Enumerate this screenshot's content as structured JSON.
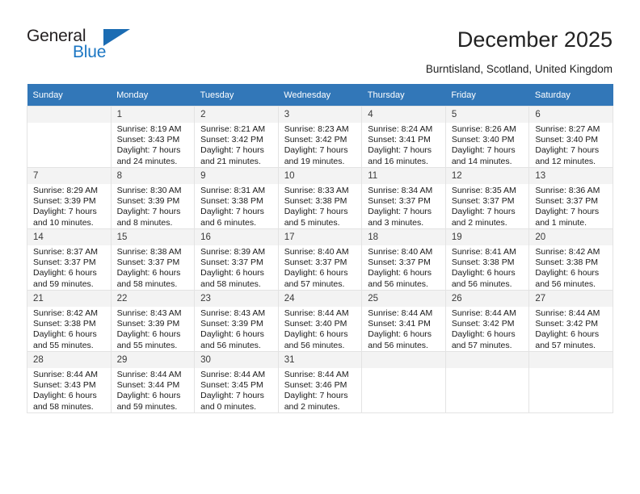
{
  "brand": {
    "name_part1": "General",
    "name_part2": "Blue",
    "triangle_icon": "blue-triangle-icon"
  },
  "header": {
    "title": "December 2025",
    "subtitle": "Burntisland, Scotland, United Kingdom"
  },
  "colors": {
    "header_row": "#3277b8",
    "brand_blue": "#1b76c3",
    "daynum_bg": "#f3f3f3",
    "cell_border": "#e3e3e3"
  },
  "weekday_headers": [
    "Sunday",
    "Monday",
    "Tuesday",
    "Wednesday",
    "Thursday",
    "Friday",
    "Saturday"
  ],
  "weeks": [
    [
      {
        "empty": true,
        "day": "",
        "sunrise": "",
        "sunset": "",
        "daylight1": "",
        "daylight2": ""
      },
      {
        "empty": false,
        "day": "1",
        "sunrise": "Sunrise: 8:19 AM",
        "sunset": "Sunset: 3:43 PM",
        "daylight1": "Daylight: 7 hours",
        "daylight2": "and 24 minutes."
      },
      {
        "empty": false,
        "day": "2",
        "sunrise": "Sunrise: 8:21 AM",
        "sunset": "Sunset: 3:42 PM",
        "daylight1": "Daylight: 7 hours",
        "daylight2": "and 21 minutes."
      },
      {
        "empty": false,
        "day": "3",
        "sunrise": "Sunrise: 8:23 AM",
        "sunset": "Sunset: 3:42 PM",
        "daylight1": "Daylight: 7 hours",
        "daylight2": "and 19 minutes."
      },
      {
        "empty": false,
        "day": "4",
        "sunrise": "Sunrise: 8:24 AM",
        "sunset": "Sunset: 3:41 PM",
        "daylight1": "Daylight: 7 hours",
        "daylight2": "and 16 minutes."
      },
      {
        "empty": false,
        "day": "5",
        "sunrise": "Sunrise: 8:26 AM",
        "sunset": "Sunset: 3:40 PM",
        "daylight1": "Daylight: 7 hours",
        "daylight2": "and 14 minutes."
      },
      {
        "empty": false,
        "day": "6",
        "sunrise": "Sunrise: 8:27 AM",
        "sunset": "Sunset: 3:40 PM",
        "daylight1": "Daylight: 7 hours",
        "daylight2": "and 12 minutes."
      }
    ],
    [
      {
        "empty": false,
        "day": "7",
        "sunrise": "Sunrise: 8:29 AM",
        "sunset": "Sunset: 3:39 PM",
        "daylight1": "Daylight: 7 hours",
        "daylight2": "and 10 minutes."
      },
      {
        "empty": false,
        "day": "8",
        "sunrise": "Sunrise: 8:30 AM",
        "sunset": "Sunset: 3:39 PM",
        "daylight1": "Daylight: 7 hours",
        "daylight2": "and 8 minutes."
      },
      {
        "empty": false,
        "day": "9",
        "sunrise": "Sunrise: 8:31 AM",
        "sunset": "Sunset: 3:38 PM",
        "daylight1": "Daylight: 7 hours",
        "daylight2": "and 6 minutes."
      },
      {
        "empty": false,
        "day": "10",
        "sunrise": "Sunrise: 8:33 AM",
        "sunset": "Sunset: 3:38 PM",
        "daylight1": "Daylight: 7 hours",
        "daylight2": "and 5 minutes."
      },
      {
        "empty": false,
        "day": "11",
        "sunrise": "Sunrise: 8:34 AM",
        "sunset": "Sunset: 3:37 PM",
        "daylight1": "Daylight: 7 hours",
        "daylight2": "and 3 minutes."
      },
      {
        "empty": false,
        "day": "12",
        "sunrise": "Sunrise: 8:35 AM",
        "sunset": "Sunset: 3:37 PM",
        "daylight1": "Daylight: 7 hours",
        "daylight2": "and 2 minutes."
      },
      {
        "empty": false,
        "day": "13",
        "sunrise": "Sunrise: 8:36 AM",
        "sunset": "Sunset: 3:37 PM",
        "daylight1": "Daylight: 7 hours",
        "daylight2": "and 1 minute."
      }
    ],
    [
      {
        "empty": false,
        "day": "14",
        "sunrise": "Sunrise: 8:37 AM",
        "sunset": "Sunset: 3:37 PM",
        "daylight1": "Daylight: 6 hours",
        "daylight2": "and 59 minutes."
      },
      {
        "empty": false,
        "day": "15",
        "sunrise": "Sunrise: 8:38 AM",
        "sunset": "Sunset: 3:37 PM",
        "daylight1": "Daylight: 6 hours",
        "daylight2": "and 58 minutes."
      },
      {
        "empty": false,
        "day": "16",
        "sunrise": "Sunrise: 8:39 AM",
        "sunset": "Sunset: 3:37 PM",
        "daylight1": "Daylight: 6 hours",
        "daylight2": "and 58 minutes."
      },
      {
        "empty": false,
        "day": "17",
        "sunrise": "Sunrise: 8:40 AM",
        "sunset": "Sunset: 3:37 PM",
        "daylight1": "Daylight: 6 hours",
        "daylight2": "and 57 minutes."
      },
      {
        "empty": false,
        "day": "18",
        "sunrise": "Sunrise: 8:40 AM",
        "sunset": "Sunset: 3:37 PM",
        "daylight1": "Daylight: 6 hours",
        "daylight2": "and 56 minutes."
      },
      {
        "empty": false,
        "day": "19",
        "sunrise": "Sunrise: 8:41 AM",
        "sunset": "Sunset: 3:38 PM",
        "daylight1": "Daylight: 6 hours",
        "daylight2": "and 56 minutes."
      },
      {
        "empty": false,
        "day": "20",
        "sunrise": "Sunrise: 8:42 AM",
        "sunset": "Sunset: 3:38 PM",
        "daylight1": "Daylight: 6 hours",
        "daylight2": "and 56 minutes."
      }
    ],
    [
      {
        "empty": false,
        "day": "21",
        "sunrise": "Sunrise: 8:42 AM",
        "sunset": "Sunset: 3:38 PM",
        "daylight1": "Daylight: 6 hours",
        "daylight2": "and 55 minutes."
      },
      {
        "empty": false,
        "day": "22",
        "sunrise": "Sunrise: 8:43 AM",
        "sunset": "Sunset: 3:39 PM",
        "daylight1": "Daylight: 6 hours",
        "daylight2": "and 55 minutes."
      },
      {
        "empty": false,
        "day": "23",
        "sunrise": "Sunrise: 8:43 AM",
        "sunset": "Sunset: 3:39 PM",
        "daylight1": "Daylight: 6 hours",
        "daylight2": "and 56 minutes."
      },
      {
        "empty": false,
        "day": "24",
        "sunrise": "Sunrise: 8:44 AM",
        "sunset": "Sunset: 3:40 PM",
        "daylight1": "Daylight: 6 hours",
        "daylight2": "and 56 minutes."
      },
      {
        "empty": false,
        "day": "25",
        "sunrise": "Sunrise: 8:44 AM",
        "sunset": "Sunset: 3:41 PM",
        "daylight1": "Daylight: 6 hours",
        "daylight2": "and 56 minutes."
      },
      {
        "empty": false,
        "day": "26",
        "sunrise": "Sunrise: 8:44 AM",
        "sunset": "Sunset: 3:42 PM",
        "daylight1": "Daylight: 6 hours",
        "daylight2": "and 57 minutes."
      },
      {
        "empty": false,
        "day": "27",
        "sunrise": "Sunrise: 8:44 AM",
        "sunset": "Sunset: 3:42 PM",
        "daylight1": "Daylight: 6 hours",
        "daylight2": "and 57 minutes."
      }
    ],
    [
      {
        "empty": false,
        "day": "28",
        "sunrise": "Sunrise: 8:44 AM",
        "sunset": "Sunset: 3:43 PM",
        "daylight1": "Daylight: 6 hours",
        "daylight2": "and 58 minutes."
      },
      {
        "empty": false,
        "day": "29",
        "sunrise": "Sunrise: 8:44 AM",
        "sunset": "Sunset: 3:44 PM",
        "daylight1": "Daylight: 6 hours",
        "daylight2": "and 59 minutes."
      },
      {
        "empty": false,
        "day": "30",
        "sunrise": "Sunrise: 8:44 AM",
        "sunset": "Sunset: 3:45 PM",
        "daylight1": "Daylight: 7 hours",
        "daylight2": "and 0 minutes."
      },
      {
        "empty": false,
        "day": "31",
        "sunrise": "Sunrise: 8:44 AM",
        "sunset": "Sunset: 3:46 PM",
        "daylight1": "Daylight: 7 hours",
        "daylight2": "and 2 minutes."
      },
      {
        "empty": true,
        "day": "",
        "sunrise": "",
        "sunset": "",
        "daylight1": "",
        "daylight2": ""
      },
      {
        "empty": true,
        "day": "",
        "sunrise": "",
        "sunset": "",
        "daylight1": "",
        "daylight2": ""
      },
      {
        "empty": true,
        "day": "",
        "sunrise": "",
        "sunset": "",
        "daylight1": "",
        "daylight2": ""
      }
    ]
  ]
}
